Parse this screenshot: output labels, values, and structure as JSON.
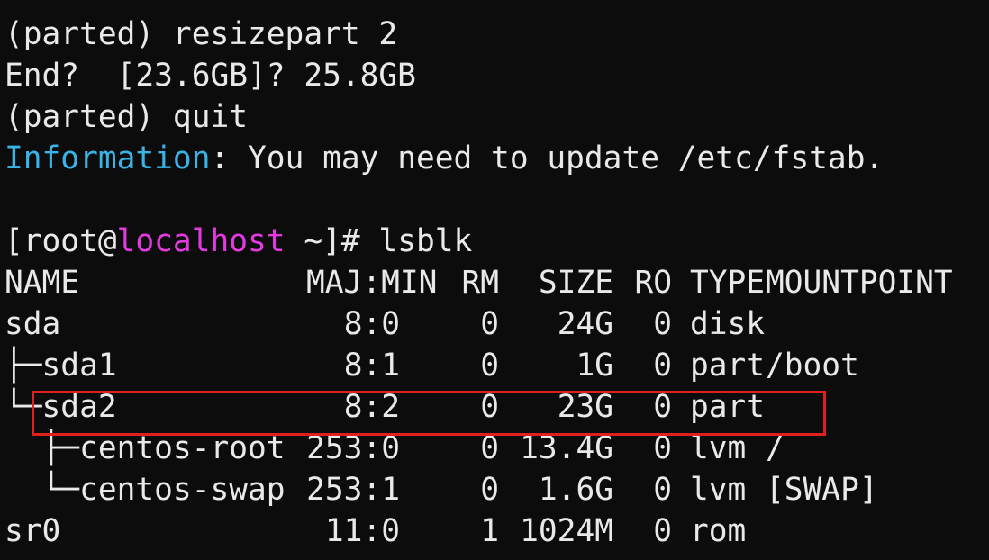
{
  "lines": {
    "cmd_resize": "(parted) resizepart 2",
    "end_prompt": "End?  [23.6GB]? 25.8GB",
    "cmd_quit": "(parted) quit",
    "info_label": "Information",
    "info_text": ": You may need to update /etc/fstab."
  },
  "prompt": {
    "prefix": "[root@",
    "host": "localhost",
    "suffix": " ~]# ",
    "command": "lsblk"
  },
  "table": {
    "headers": {
      "name": "NAME",
      "majmin": "MAJ:MIN",
      "rm": "RM",
      "size": "SIZE",
      "ro": "RO",
      "type": "TYPE",
      "mount": "MOUNTPOINT"
    },
    "rows": [
      {
        "name": "sda",
        "majmin": "8:0",
        "rm": "0",
        "size": "24G",
        "ro": "0",
        "type": "disk",
        "mount": ""
      },
      {
        "name": "├─sda1",
        "majmin": "8:1",
        "rm": "0",
        "size": "1G",
        "ro": "0",
        "type": "part",
        "mount": "/boot"
      },
      {
        "name": "└─sda2",
        "majmin": "8:2",
        "rm": "0",
        "size": "23G",
        "ro": "0",
        "type": "part",
        "mount": ""
      },
      {
        "name": "  ├─centos-root",
        "majmin": "253:0",
        "rm": "0",
        "size": "13.4G",
        "ro": "0",
        "type": "lvm",
        "mount": "/"
      },
      {
        "name": "  └─centos-swap",
        "majmin": "253:1",
        "rm": "0",
        "size": "1.6G",
        "ro": "0",
        "type": "lvm",
        "mount": "[SWAP]"
      },
      {
        "name": "sr0",
        "majmin": "11:0",
        "rm": "1",
        "size": "1024M",
        "ro": "0",
        "type": "rom",
        "mount": ""
      }
    ]
  },
  "colors": {
    "background": "#0c0c0c",
    "foreground": "#e9e9e9",
    "info": "#3ab3e6",
    "host": "#e23ae0",
    "highlight": "#e0201c"
  }
}
